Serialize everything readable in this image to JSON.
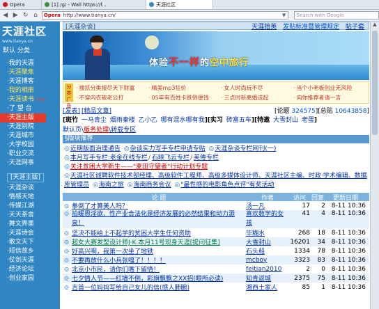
{
  "browser": {
    "tabs": [
      {
        "label": "Opera",
        "color": "#cc1b1b"
      },
      {
        "label": "[1] /g/ - Wall https://f...",
        "color": "#3a8d3a"
      },
      {
        "label": "天涯社区",
        "color": "#2f86c3"
      }
    ],
    "address": "http://www.tianya.cn/",
    "opera_badge": "Opera",
    "search_placeholder": "Search with Google"
  },
  "sidebar": {
    "logo_text": "天涯社区",
    "logo_sub": "www.tianya.cn",
    "items": [
      {
        "label": "默认 分类",
        "style": "pre"
      },
      {
        "label": "我的天涯",
        "style": "dot"
      },
      {
        "label": "天涯聚焦",
        "style": "dot",
        "highlight": true
      },
      {
        "label": "天涯博客",
        "style": "dot"
      },
      {
        "label": "我的相册",
        "style": "dot",
        "highlight": true
      },
      {
        "label": "天涯读书",
        "style": "dot",
        "highlight": true,
        "badge": "new"
      },
      {
        "label": "了 望 台",
        "style": "dot"
      },
      {
        "label": "天涯主版",
        "style": "dot",
        "red": true
      },
      {
        "label": "天涯别院",
        "style": "dot"
      },
      {
        "label": "天涯城市",
        "style": "dot"
      },
      {
        "label": "大学校园",
        "style": "dot"
      },
      {
        "label": "职业交流",
        "style": "dot"
      },
      {
        "label": "天涯网事",
        "style": "dot"
      }
    ],
    "sub_header": "[天涯主版]",
    "sub_items": [
      "天涯杂谈",
      "情感天地",
      "传媒江湖",
      "天天茶舍",
      "舞文弄墨",
      "天涯诗会",
      "散文天下",
      "短信故乡",
      "仗剑天涯",
      "经济论坛",
      "创业家园"
    ]
  },
  "main": {
    "section_title": "[天涯杂谈]",
    "head_links": [
      "天涯拾英",
      "发贴标准暨管理规定",
      "帖子套"
    ],
    "banner": {
      "t1": "体验",
      "t2": "不一样",
      "t3": "的",
      "t4": "空中旅行"
    },
    "promo_badge": "分类广告",
    "promo": [
      "搜凯分类报尽天下财富",
      "精美mp3狂价",
      "女人时尚玩不尽",
      "当个小老板创业无风险",
      "不穿内衣被老公打",
      "05年有百姓卡跌倒便钱",
      "三点时新离婚送起",
      "向你推荐者请一言"
    ],
    "actions": [
      "[发表]",
      "[精品文章]"
    ],
    "stats": {
      "label1": "[论题 ",
      "topics": "324575",
      "label2": "][总贴 ",
      "posts": "10643858",
      "label3": "]"
    },
    "tags": [
      {
        "b": "[斑竹",
        "items": [
          "一马青尘",
          "烟雨秦楼",
          "乙小乙",
          "哪有混水哪有我"
        ],
        "end": "]"
      },
      {
        "b": "[实习",
        "items": [
          "砖富五车"
        ],
        "end": "]"
      },
      {
        "b": "[特邀",
        "items": [
          "大雪封山",
          "老蛋"
        ],
        "end": "]"
      }
    ],
    "crumb": {
      "c1": "默认页\\",
      "c2": "版务处理",
      "c3": "\\转载专区"
    },
    "notice_title": "§版块推荐",
    "notices": [
      [
        "近期版面治理通告",
        "杂谈实力写手专栏申请专贴",
        "天涯杂谈专栏网刊(一)"
      ],
      [
        "本月写手专栏:老金在线专栏",
        "石映飞云专栏",
        "芙倦专栏"
      ],
      [
        "关注贫困大学新生——\"麦田守望者\"行动计划专题"
      ],
      [
        "天涯社区诚聘软件技术部经理、高级软件工程师、高级多媒体设计师、天涯社区主编、时政·学术编辑、数据库管理员",
        "海南之旅",
        "海南商务会议",
        "\"最性感的电影角色点评\"有奖活动"
      ]
    ],
    "table": {
      "headers": [
        "论 题",
        "作者",
        "访问",
        "回复",
        "更新日期"
      ],
      "rows": [
        {
          "title": "拳倒了才算美人吗？",
          "author": "汤一凡",
          "visits": "17",
          "replies": "2",
          "date": "8-11 10:36",
          "tall": false,
          "green": false
        },
        {
          "title": "拍暖恩淫欲、性产业合法化是经济发展的必然结果和动力源泉！",
          "author": "喜欢数学的女孩",
          "visits": "41",
          "replies": "4",
          "date": "8-11 10:36",
          "tall": true,
          "green": false
        },
        {
          "title": "坚决不能给上不起学的贫困大学生任何资助",
          "author": "毕糊水",
          "visits": "268",
          "replies": "18",
          "date": "8-11 10:36",
          "tall": false,
          "green": false
        },
        {
          "title": "超女大赛发型设计师J·K 本月11号现身天涯[提问征集]",
          "author": "大雪封山",
          "visits": "16201",
          "replies": "34",
          "date": "8-11 10:36",
          "tall": false,
          "green": true
        },
        {
          "title": "好高兴啊，我第一次坐了地铁",
          "author": "石头船",
          "visits": "1334",
          "replies": "78",
          "date": "8-11 10:36",
          "tall": false,
          "green": false
        },
        {
          "title": "不要再放什么小兵张嘎了！！！！",
          "author": "mcboy",
          "visits": "3323",
          "replies": "83",
          "date": "8-11 10:36",
          "tall": false,
          "green": false
        },
        {
          "title": "北京小市民，请你们嘴下留情！",
          "author": "feitian2010",
          "visits": "2",
          "replies": "0",
          "date": "8-11 10:36",
          "tall": false,
          "green": false
        },
        {
          "title": "七夕情人节——红墙不倒，彩旗飘飘之XX招(眼所必读)",
          "author": "知青返城",
          "visits": "2375",
          "replies": "75",
          "date": "8-11 10:36",
          "tall": false,
          "green": false
        },
        {
          "title": "吉首一位妈妈写给自己女儿的信(感人肺腑)",
          "author": "湘西土家人",
          "visits": "85",
          "replies": "1",
          "date": "8-11 10:36",
          "tall": false,
          "green": false
        }
      ]
    }
  }
}
